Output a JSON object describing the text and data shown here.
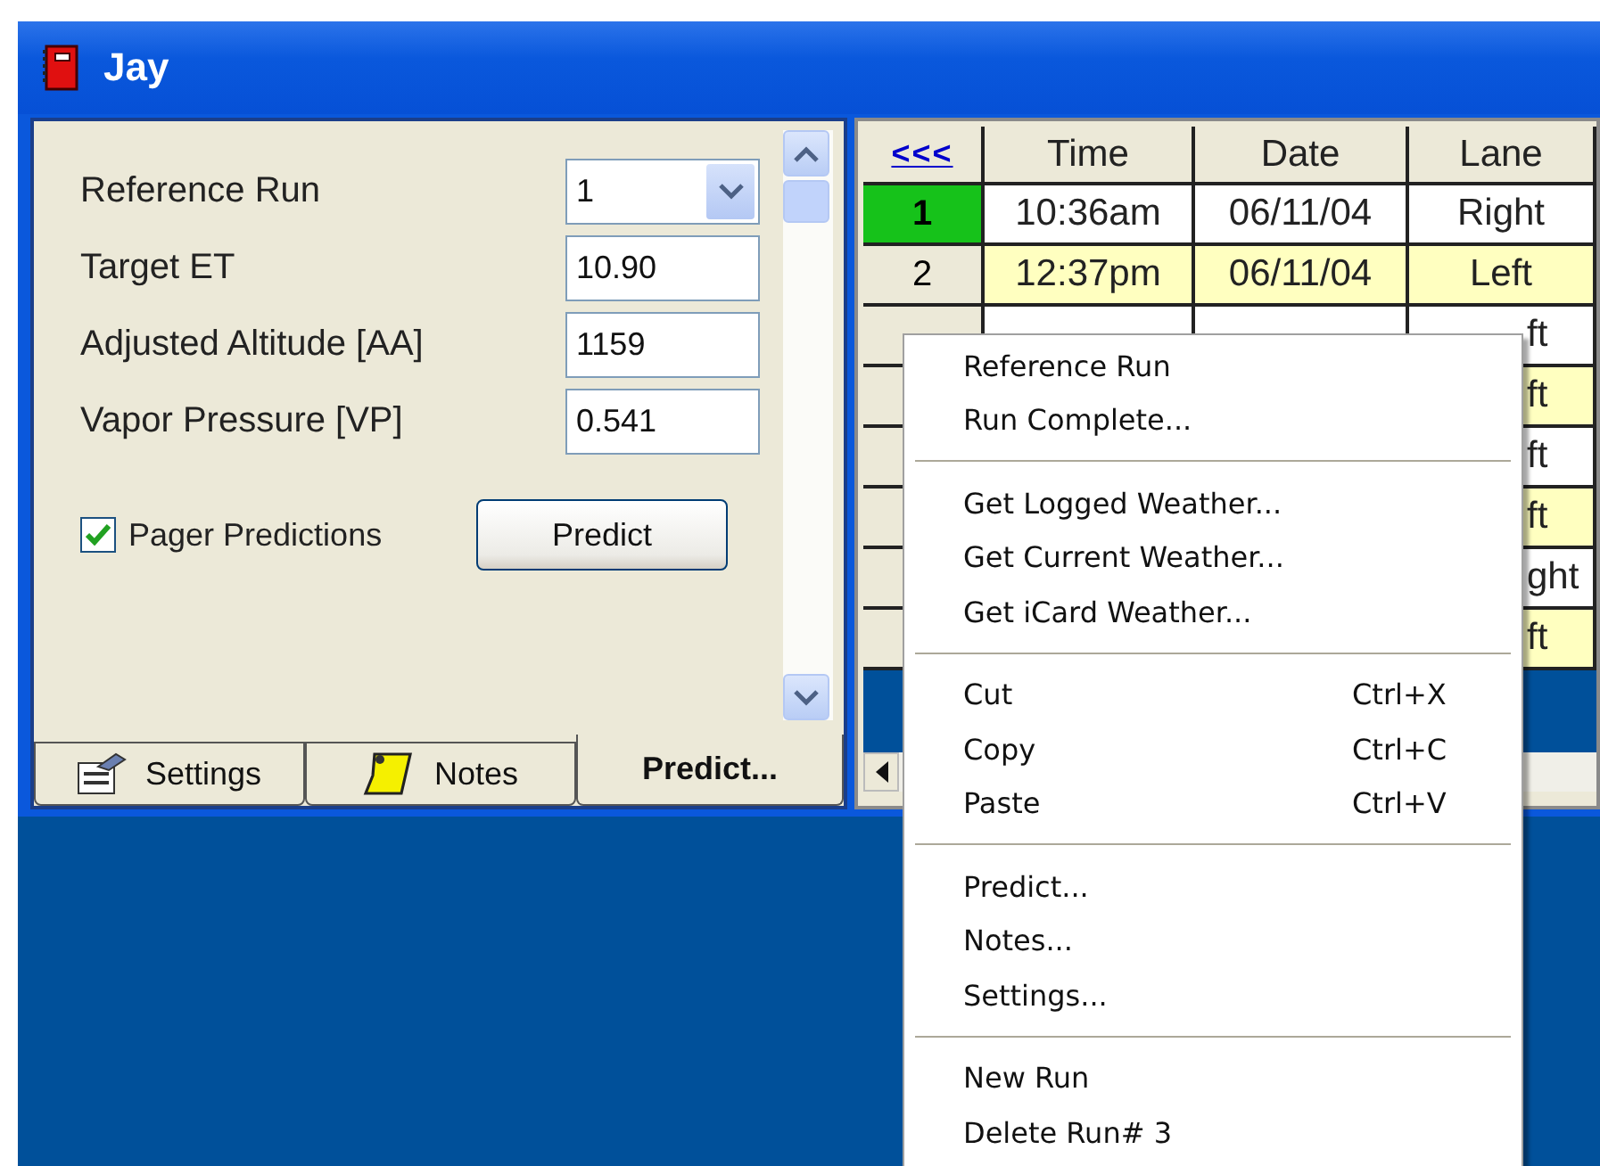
{
  "window": {
    "title": "Jay"
  },
  "form": {
    "fields": [
      {
        "kind": "dropdown",
        "label": "Reference Run",
        "value": "1"
      },
      {
        "kind": "text",
        "label": "Target ET",
        "value": "10.90"
      },
      {
        "kind": "text",
        "label": "Adjusted Altitude [AA]",
        "value": "1159"
      },
      {
        "kind": "text",
        "label": "Vapor Pressure [VP]",
        "value": "0.541"
      }
    ],
    "checkbox": {
      "label": "Pager Predictions",
      "checked": true
    },
    "button": "Predict"
  },
  "tabs": [
    {
      "label": "Settings",
      "selected": false
    },
    {
      "label": "Notes",
      "selected": false
    },
    {
      "label": "Predict...",
      "selected": true
    }
  ],
  "table": {
    "back_link": "<<<",
    "columns": [
      "Time",
      "Date",
      "Lane"
    ],
    "rows": [
      {
        "number": "1",
        "time": "10:36am",
        "date": "06/11/04",
        "lane": "Right",
        "reference": true,
        "shaded": false
      },
      {
        "number": "2",
        "time": "12:37pm",
        "date": "06/11/04",
        "lane": "Left",
        "reference": false,
        "shaded": true
      },
      {
        "lane": "ft",
        "reference": false,
        "shaded": false
      },
      {
        "lane": "ft",
        "reference": false,
        "shaded": true
      },
      {
        "lane": "ft",
        "reference": false,
        "shaded": false
      },
      {
        "lane": "ft",
        "reference": false,
        "shaded": true
      },
      {
        "lane": "ght",
        "reference": false,
        "shaded": false
      },
      {
        "lane": "ft",
        "reference": false,
        "shaded": true
      }
    ]
  },
  "context_menu": {
    "groups": [
      [
        {
          "label": "Reference Run"
        },
        {
          "label": "Run Complete..."
        }
      ],
      [
        {
          "label": "Get Logged Weather..."
        },
        {
          "label": "Get Current Weather..."
        },
        {
          "label": "Get iCard Weather..."
        }
      ],
      [
        {
          "label": "Cut",
          "shortcut": "Ctrl+X"
        },
        {
          "label": "Copy",
          "shortcut": "Ctrl+C"
        },
        {
          "label": "Paste",
          "shortcut": "Ctrl+V"
        }
      ],
      [
        {
          "label": "Predict..."
        },
        {
          "label": "Notes..."
        },
        {
          "label": "Settings..."
        }
      ],
      [
        {
          "label": "New Run"
        },
        {
          "label": "Delete Run# 3"
        }
      ]
    ]
  }
}
